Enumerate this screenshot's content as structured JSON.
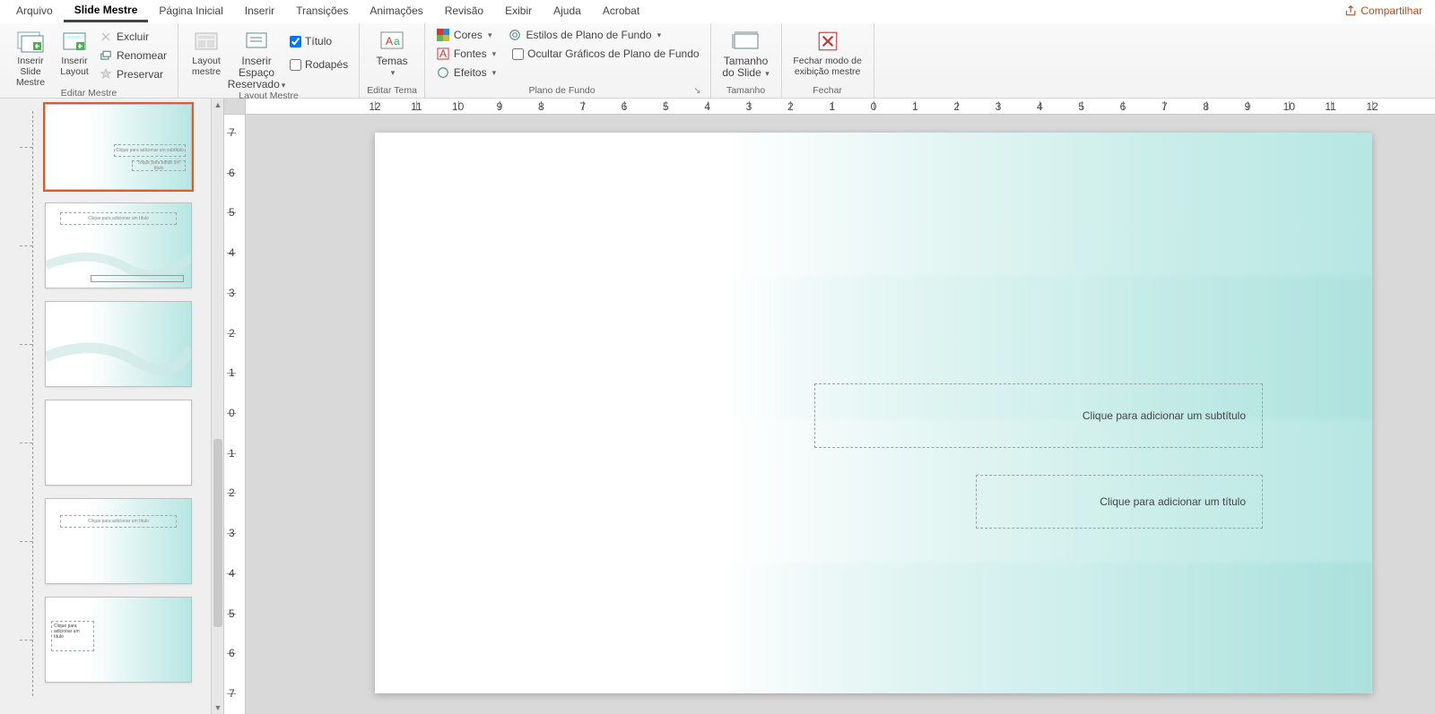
{
  "tabs": {
    "arquivo": "Arquivo",
    "slide_mestre": "Slide Mestre",
    "pagina_inicial": "Página Inicial",
    "inserir": "Inserir",
    "transicoes": "Transições",
    "animacoes": "Animações",
    "revisao": "Revisão",
    "exibir": "Exibir",
    "ajuda": "Ajuda",
    "acrobat": "Acrobat"
  },
  "share": "Compartilhar",
  "ribbon": {
    "editar_mestre": {
      "label": "Editar Mestre",
      "inserir_slide_mestre": "Inserir Slide\nMestre",
      "inserir_layout": "Inserir\nLayout",
      "excluir": "Excluir",
      "renomear": "Renomear",
      "preservar": "Preservar"
    },
    "layout_mestre": {
      "label": "Layout Mestre",
      "layout_mestre": "Layout\nmestre",
      "inserir_espaco": "Inserir Espaço\nReservado",
      "titulo": "Título",
      "rodapes": "Rodapés"
    },
    "editar_tema": {
      "label": "Editar Tema",
      "temas": "Temas"
    },
    "plano_fundo": {
      "label": "Plano de Fundo",
      "cores": "Cores",
      "fontes": "Fontes",
      "efeitos": "Efeitos",
      "estilos": "Estilos de Plano de Fundo",
      "ocultar": "Ocultar Gráficos de Plano de Fundo"
    },
    "tamanho": {
      "label": "Tamanho",
      "btn": "Tamanho\ndo Slide"
    },
    "fechar": {
      "label": "Fechar",
      "btn": "Fechar modo de\nexibição mestre"
    }
  },
  "slide": {
    "subtitle_placeholder": "Clique para adicionar um subtítulo",
    "title_placeholder": "Clique para adicionar um título"
  },
  "thumbs": {
    "mini_title": "Clique para adicionar um título",
    "mini_sub": "Clique para adicionar um subtítulo",
    "mini_sub2": "Toque para editar um título",
    "t5_line1": "Clique para",
    "t5_line2": "adicionar um",
    "t5_line3": "título"
  },
  "ruler_h": [
    12,
    11,
    10,
    9,
    8,
    7,
    6,
    5,
    4,
    3,
    2,
    1,
    0,
    1,
    2,
    3,
    4,
    5,
    6,
    7,
    8,
    9,
    10,
    11,
    12
  ],
  "ruler_v": [
    7,
    6,
    5,
    4,
    3,
    2,
    1,
    0,
    1,
    2,
    3,
    4,
    5,
    6,
    7
  ]
}
